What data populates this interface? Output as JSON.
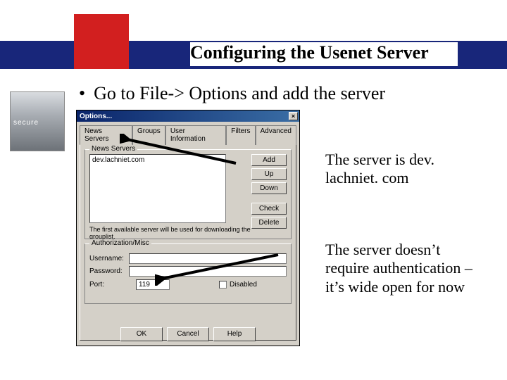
{
  "slide": {
    "title": "Configuring the Usenet Server",
    "bullet": "Go to File-> Options and add the server",
    "side_badge": "secure"
  },
  "dialog": {
    "title": "Options...",
    "tabs": [
      "News Servers",
      "Groups",
      "User Information",
      "Filters",
      "Advanced"
    ],
    "group_servers_label": "News Servers",
    "server_entry": "dev.lachniet.com",
    "buttons": {
      "add": "Add",
      "up": "Up",
      "down": "Down",
      "check": "Check",
      "delete": "Delete"
    },
    "hint": "The first available server will be used for downloading the grouplist.",
    "group_auth_label": "Authorization/Misc",
    "username_label": "Username:",
    "password_label": "Password:",
    "username_value": "",
    "password_value": "",
    "port_label": "Port:",
    "port_value": "119",
    "disabled_label": "Disabled",
    "ok": "OK",
    "cancel": "Cancel",
    "help": "Help"
  },
  "annotations": {
    "a1": "The server is dev. lachniet. com",
    "a2": "The server doesn’t require authentication – it’s wide open for now"
  }
}
